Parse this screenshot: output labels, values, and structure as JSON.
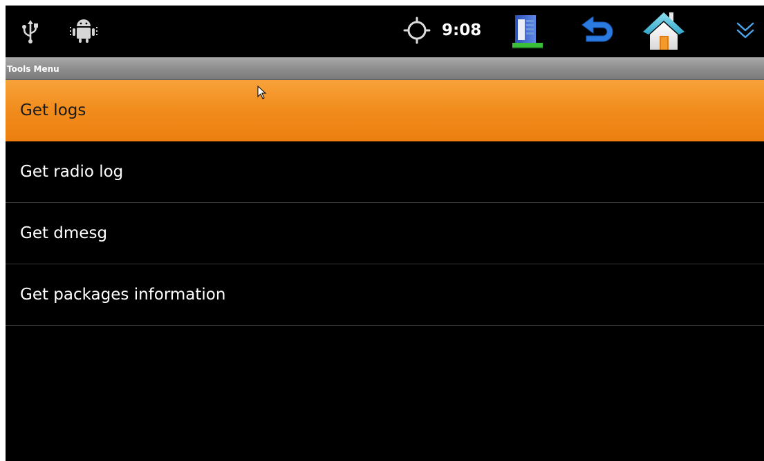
{
  "status_bar": {
    "time": "9:08",
    "icons": {
      "usb": "usb-icon",
      "debug": "android-debug-icon",
      "location": "gps-icon",
      "recent_apps": "recent-apps-icon",
      "back": "back-icon",
      "home": "home-icon",
      "menu": "chevron-double-down-icon"
    }
  },
  "title_bar": {
    "title": "Tools Menu"
  },
  "menu": {
    "items": [
      {
        "label": "Get logs",
        "selected": true
      },
      {
        "label": "Get radio log",
        "selected": false
      },
      {
        "label": "Get dmesg",
        "selected": false
      },
      {
        "label": "Get packages information",
        "selected": false
      }
    ]
  },
  "colors": {
    "selected_item": "#f18c1c",
    "background": "#000000",
    "title_bar": "#8c8c8c",
    "back_icon": "#2a7ae0",
    "chevron": "#4aa3e8"
  }
}
